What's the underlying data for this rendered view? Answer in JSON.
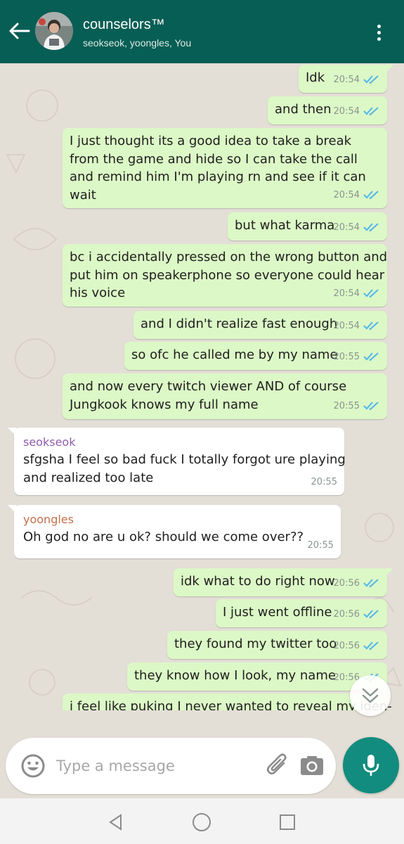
{
  "header": {
    "title": "counselors™",
    "subtitle": "seokseok, yoongles, You",
    "back_icon": "arrow-left-icon",
    "menu_icon": "more-vertical-icon",
    "bg_color": "#075e54"
  },
  "messages": [
    {
      "text": "Idk",
      "time": "20:54",
      "status": "read"
    },
    {
      "text": "and then",
      "time": "20:54",
      "status": "read"
    },
    {
      "text": "I just thought its a good idea to take a break\nfrom the game and hide so I can take the call\nand remind him I'm playing rn and see if it can\nwait",
      "time": "20:54",
      "status": "read"
    },
    {
      "text": "but what karma",
      "time": "20:54",
      "status": "read"
    },
    {
      "text": "bc i accidentally pressed on the wrong button and\nput him on speakerphone so everyone could hear\nhis voice",
      "time": "20:54",
      "status": "read"
    },
    {
      "text": "and I didn't realize fast enough",
      "time": "20:54",
      "status": "read"
    },
    {
      "text": "so ofc he called me by my name",
      "time": "20:55",
      "status": "read"
    },
    {
      "text": "and now every twitch viewer AND of course\nJungkook knows my full name",
      "time": "20:55",
      "status": "read"
    },
    {
      "sender": "seokseok",
      "text": "sfgsha I feel so bad fuck I totally forgot ure playing\nand realized too late",
      "time": "20:55",
      "sender_color": "#8e5ca8"
    },
    {
      "sender": "yoongles",
      "text": "Oh god no are u ok? should we come over??",
      "time": "20:55",
      "sender_color": "#c2704a"
    },
    {
      "text": "idk what to do right now",
      "time": "20:56",
      "status": "read"
    },
    {
      "text": "I just went offline",
      "time": "20:56",
      "status": "read"
    },
    {
      "text": "they found my twitter too",
      "time": "20:56",
      "status": "read"
    },
    {
      "text": "they know how I look, my name",
      "time": "20:56",
      "status": "read"
    },
    {
      "text": "i feel like puking I never wanted to reveal my iden-\ntity to everyone on twitch or Twitter fuck I don't",
      "time": "",
      "status": "read"
    }
  ],
  "composer": {
    "placeholder": "Type a message",
    "emoji_icon": "smiley-icon",
    "attach_icon": "paperclip-icon",
    "camera_icon": "camera-icon",
    "mic_icon": "microphone-icon",
    "accent_color": "#128c7e"
  },
  "scroll_down_icon": "double-chevron-down-icon",
  "navbar": {
    "back_icon": "triangle-back-icon",
    "home_icon": "circle-home-icon",
    "recents_icon": "square-recents-icon"
  },
  "colors": {
    "outgoing_bubble": "#dcf8c6",
    "incoming_bubble": "#ffffff",
    "read_tick": "#4fb6ec",
    "chat_bg": "#e3ded6"
  }
}
